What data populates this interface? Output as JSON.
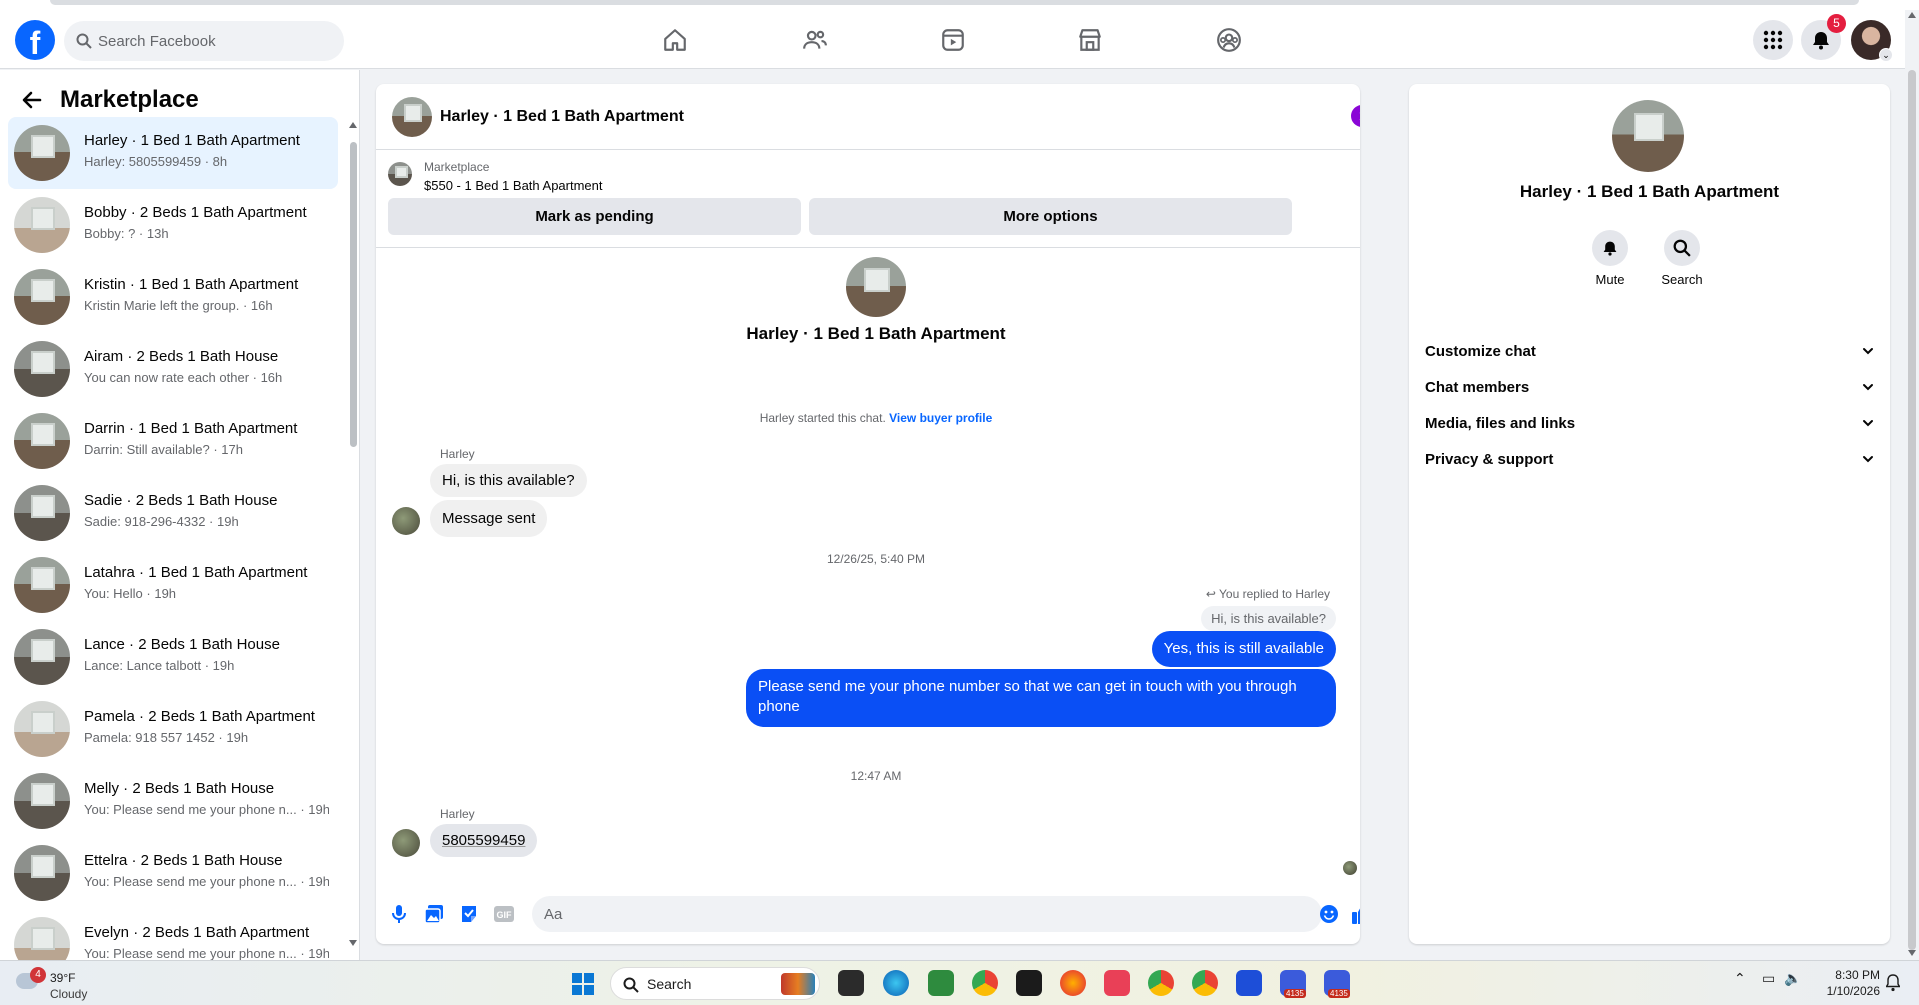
{
  "topnav": {
    "logo": "f",
    "search_placeholder": "Search Facebook",
    "icons": [
      "home-icon",
      "friends-icon",
      "video-icon",
      "marketplace-icon",
      "groups-icon"
    ],
    "notification_count": "5"
  },
  "sidebar": {
    "title": "Marketplace",
    "conversations": [
      {
        "title": "Harley · 1 Bed 1 Bath Apartment",
        "preview": "Harley: 5805599459 · 8h",
        "active": true
      },
      {
        "title": "Bobby · 2 Beds 1 Bath Apartment",
        "preview": "Bobby: ? · 13h"
      },
      {
        "title": "Kristin · 1 Bed 1 Bath Apartment",
        "preview": "Kristin Marie left the group. · 16h"
      },
      {
        "title": "Airam · 2 Beds 1 Bath House",
        "preview": "You can now rate each other · 16h"
      },
      {
        "title": "Darrin · 1 Bed 1 Bath Apartment",
        "preview": "Darrin: Still available? · 17h"
      },
      {
        "title": "Sadie · 2 Beds 1 Bath House",
        "preview": "Sadie: 918-296-4332 · 19h"
      },
      {
        "title": "Latahra · 1 Bed 1 Bath Apartment",
        "preview": "You: Hello · 19h"
      },
      {
        "title": "Lance · 2 Beds 1 Bath House",
        "preview": "Lance: Lance talbott · 19h"
      },
      {
        "title": "Pamela · 2 Beds 1 Bath Apartment",
        "preview": "Pamela: 918 557 1452 · 19h"
      },
      {
        "title": "Melly · 2 Beds 1 Bath House",
        "preview": "You: Please send me your phone n... · 19h"
      },
      {
        "title": "Ettelra · 2 Beds 1 Bath House",
        "preview": "You: Please send me your phone n... · 19h"
      },
      {
        "title": "Evelyn · 2 Beds 1 Bath Apartment",
        "preview": "You: Please send me your phone n... · 19h"
      }
    ]
  },
  "chat": {
    "header_title": "Harley · 1 Bed 1 Bath Apartment",
    "marketplace_label": "Marketplace",
    "listing": "$550 - 1 Bed 1 Bath Apartment",
    "mark_pending": "Mark as pending",
    "more_options": "More options",
    "intro_name": "Harley · 1 Bed 1 Bath Apartment",
    "started_text": "Harley started this chat. ",
    "view_buyer": "View buyer profile",
    "sender_1": "Harley",
    "msg_1": "Hi, is this available?",
    "msg_2": "Message sent",
    "timestamp_1": "12/26/25, 5:40 PM",
    "replied_to": "You replied to Harley",
    "quoted": "Hi, is this available?",
    "reply_1": "Yes, this is still available",
    "reply_2": "Please send me your phone  number so that we can get in touch with you through phone",
    "timestamp_2": "12:47 AM",
    "sender_2": "Harley",
    "msg_3": "5805599459",
    "composer_placeholder": "Aa"
  },
  "info_panel": {
    "name": "Harley · 1 Bed 1 Bath Apartment",
    "mute": "Mute",
    "search": "Search",
    "sections": [
      "Customize chat",
      "Chat members",
      "Media, files and links",
      "Privacy & support"
    ]
  },
  "taskbar": {
    "weather_badge": "4",
    "temperature": "39°F",
    "condition": "Cloudy",
    "search_label": "Search",
    "app_count": "4135",
    "time": "8:30 PM",
    "date": "1/10/2026"
  },
  "colors": {
    "brand": "#0866ff",
    "outgoing_bubble": "#0a4ff5",
    "info_accent": "#8a06d6"
  }
}
